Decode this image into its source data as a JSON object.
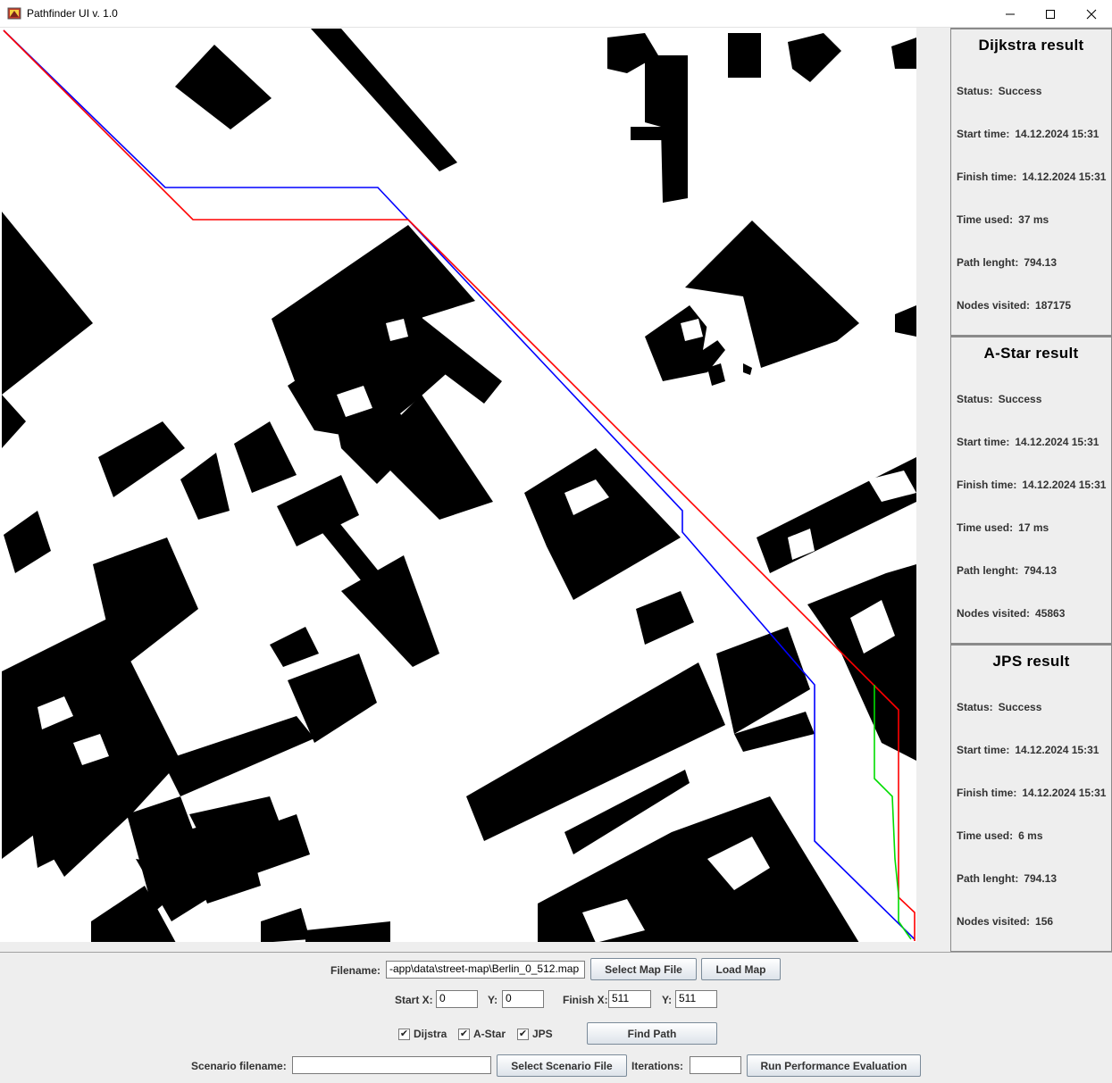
{
  "window": {
    "title": "Pathfinder UI v. 1.0"
  },
  "results": [
    {
      "title": "Dijkstra result",
      "status_label": "Status:",
      "status": "Success",
      "start_label": "Start time:",
      "start": "14.12.2024 15:31",
      "finish_label": "Finish time:",
      "finish": "14.12.2024 15:31",
      "time_label": "Time used:",
      "time": "37 ms",
      "length_label": "Path lenght:",
      "length": "794.13",
      "nodes_label": "Nodes visited:",
      "nodes": "187175"
    },
    {
      "title": "A-Star result",
      "status_label": "Status:",
      "status": "Success",
      "start_label": "Start time:",
      "start": "14.12.2024 15:31",
      "finish_label": "Finish time:",
      "finish": "14.12.2024 15:31",
      "time_label": "Time used:",
      "time": "17 ms",
      "length_label": "Path lenght:",
      "length": "794.13",
      "nodes_label": "Nodes visited:",
      "nodes": "45863"
    },
    {
      "title": "JPS result",
      "status_label": "Status:",
      "status": "Success",
      "start_label": "Start time:",
      "start": "14.12.2024 15:31",
      "finish_label": "Finish time:",
      "finish": "14.12.2024 15:31",
      "time_label": "Time used:",
      "time": "6 ms",
      "length_label": "Path lenght:",
      "length": "794.13",
      "nodes_label": "Nodes visited:",
      "nodes": "156"
    }
  ],
  "controls": {
    "filename_label": "Filename:",
    "filename_value": "-app\\data\\street-map\\Berlin_0_512.map",
    "select_map_button": "Select Map File",
    "load_map_button": "Load Map",
    "start_x_label": "Start X:",
    "start_x_value": "0",
    "start_y_label": "Y:",
    "start_y_value": "0",
    "finish_x_label": "Finish X:",
    "finish_x_value": "511",
    "finish_y_label": "Y:",
    "finish_y_value": "511",
    "checkboxes": [
      {
        "label": "Dijstra",
        "checked": true
      },
      {
        "label": "A-Star",
        "checked": true
      },
      {
        "label": "JPS",
        "checked": true
      }
    ],
    "find_path_button": "Find Path",
    "scenario_label": "Scenario filename:",
    "scenario_value": "",
    "select_scenario_button": "Select Scenario File",
    "iterations_label": "Iterations:",
    "iterations_value": "",
    "run_eval_button": "Run Performance Evaluation"
  },
  "colors": {
    "dijkstra_path": "#ff0000",
    "astar_path": "#0000ff",
    "jps_path": "#00dd00",
    "obstacle": "#000000",
    "free": "#ffffff"
  }
}
